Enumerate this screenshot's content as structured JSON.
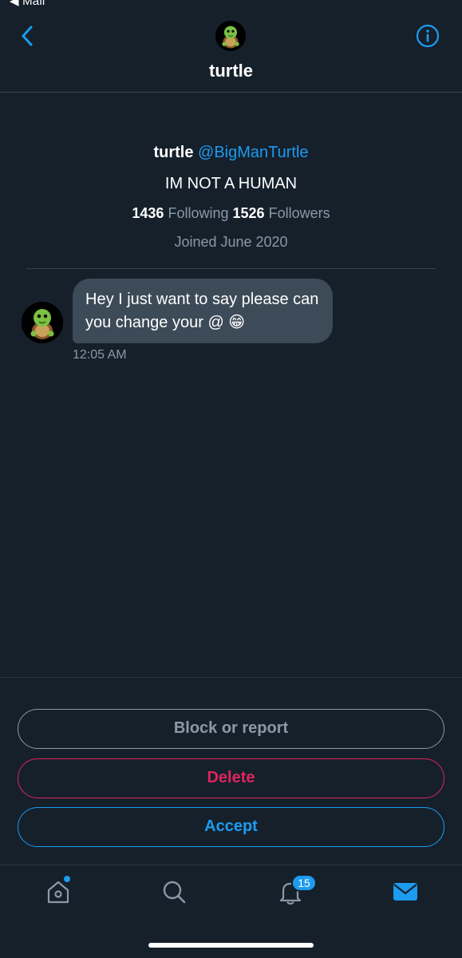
{
  "status_bar": {
    "back_app": "◀ Mail"
  },
  "header": {
    "title": "turtle"
  },
  "profile": {
    "name": "turtle",
    "handle": "@BigManTurtle",
    "bio": "IM NOT A HUMAN",
    "following_count": "1436",
    "following_label": "Following",
    "followers_count": "1526",
    "followers_label": "Followers",
    "joined": "Joined June 2020"
  },
  "message": {
    "text": "Hey I just want to say please can you change your @ 😁",
    "time": "12:05 AM"
  },
  "actions": {
    "block_label": "Block or report",
    "delete_label": "Delete",
    "accept_label": "Accept"
  },
  "tabbar": {
    "items": [
      {
        "icon": "home-icon"
      },
      {
        "icon": "search-icon"
      },
      {
        "icon": "bell-icon",
        "badge": "15"
      },
      {
        "icon": "mail-icon"
      }
    ]
  },
  "colors": {
    "background": "#15202b",
    "accent": "#1d9bf0",
    "danger": "#e0245e",
    "muted": "#8b98a5",
    "bubble": "#3d4b58"
  }
}
